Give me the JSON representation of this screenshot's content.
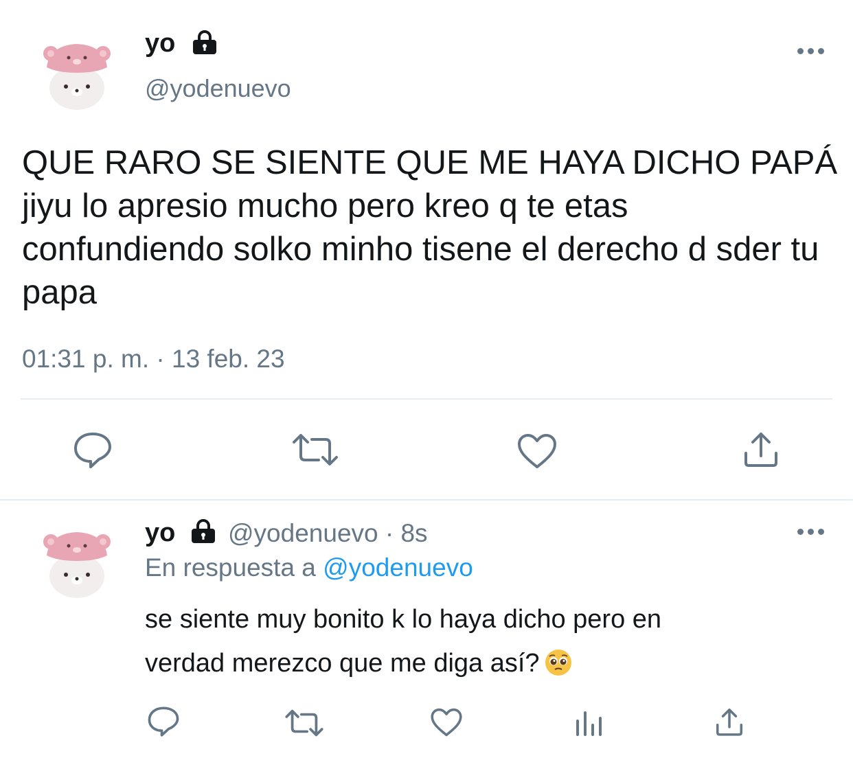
{
  "colors": {
    "text": "#14171a",
    "secondary": "#657786",
    "link": "#1d9bf0",
    "divider": "#e6ecf0"
  },
  "main_tweet": {
    "display_name": "yo",
    "handle": "@yodenuevo",
    "text": "QUE RARO SE SIENTE QUE ME HAYA DICHO PAPÁ jiyu lo apresio mucho pero kreo q te etas confundiendo solko minho tisene el derecho d sder tu papa",
    "timestamp": "01:31 p. m. · 13 feb. 23",
    "actions": [
      "reply-icon",
      "retweet-icon",
      "like-icon",
      "share-icon"
    ]
  },
  "reply_tweet": {
    "display_name": "yo",
    "handle_time": "@yodenuevo · 8s",
    "in_reply_prefix": "En respuesta a",
    "in_reply_handle": "@yodenuevo",
    "text_line1": "se siente muy bonito k lo haya dicho pero en",
    "text_line2": "verdad merezco que me diga así?",
    "emoji": "pleading-face",
    "actions": [
      "reply-icon",
      "retweet-icon",
      "like-icon",
      "analytics-icon",
      "share-icon"
    ]
  }
}
